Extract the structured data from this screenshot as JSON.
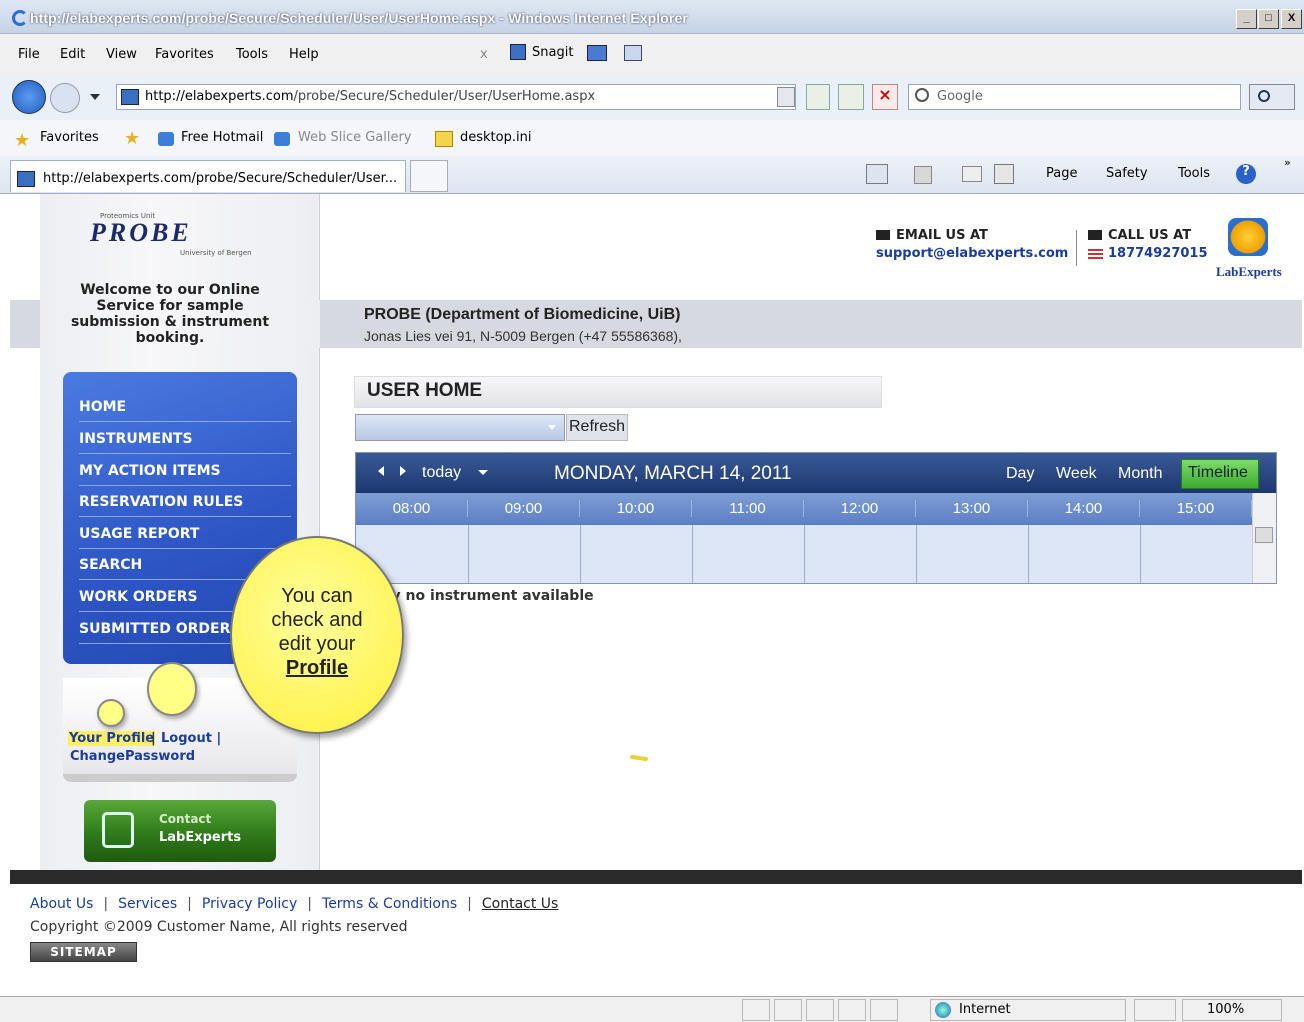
{
  "window": {
    "title": "http://elabexperts.com/probe/Secure/Scheduler/User/UserHome.aspx - Windows Internet Explorer",
    "min": "_",
    "max": "□",
    "close": "X"
  },
  "menu": {
    "items": [
      "File",
      "Edit",
      "View",
      "Favorites",
      "Tools",
      "Help"
    ],
    "close_x": "x",
    "snagit": "Snagit"
  },
  "address": {
    "url_dark": "http://elabexperts.com",
    "url_rest": "/probe/Secure/Scheduler/User/UserHome.aspx",
    "search_placeholder": "Google"
  },
  "favorites": {
    "label": "Favorites",
    "items": [
      "Free Hotmail",
      "Web Slice Gallery",
      "desktop.ini"
    ]
  },
  "tab": {
    "title": "http://elabexperts.com/probe/Secure/Scheduler/User...",
    "tools": [
      "Page",
      "Safety",
      "Tools"
    ]
  },
  "header": {
    "logo_small": "Proteomics Unit",
    "logo": "PROBE",
    "logo_sub": "University of Bergen",
    "email_label": "EMAIL US AT",
    "email": "support@elabexperts.com",
    "call_label": "CALL US AT",
    "phone": "18774927015",
    "brand": "LabExperts"
  },
  "welcome": "Welcome to our Online Service for sample submission & instrument booking.",
  "org": {
    "name": "PROBE (Department of Biomedicine, UiB)",
    "address": "Jonas Lies vei 91, N-5009 Bergen (+47 55586368),"
  },
  "nav": [
    "HOME",
    "INSTRUMENTS",
    "MY ACTION ITEMS",
    "RESERVATION RULES",
    "USAGE REPORT",
    "SEARCH",
    "WORK ORDERS",
    "SUBMITTED ORDERS"
  ],
  "profile": {
    "your_profile": "Your Profile",
    "sep": "|",
    "logout": "Logout |",
    "change_password": "ChangePassword"
  },
  "contact": {
    "line1": "Contact",
    "line2": "LabExperts"
  },
  "main": {
    "title": "USER HOME",
    "refresh": "Refresh",
    "no_instrument": "tly no instrument available"
  },
  "calendar": {
    "today": "today",
    "date": "MONDAY, MARCH 14, 2011",
    "views": [
      "Day",
      "Week",
      "Month",
      "Timeline"
    ],
    "hours": [
      "08:00",
      "09:00",
      "10:00",
      "11:00",
      "12:00",
      "13:00",
      "14:00",
      "15:00"
    ]
  },
  "callout": {
    "line1": "You can",
    "line2": "check and",
    "line3": "edit your",
    "profile": "Profile"
  },
  "footer": {
    "links": [
      "About Us",
      "Services",
      "Privacy Policy",
      "Terms & Conditions",
      "Contact Us"
    ],
    "copyright": "Copyright ©2009 Customer Name, All rights reserved",
    "sitemap": "SITEMAP"
  },
  "status": {
    "zone": "Internet",
    "zoom": "100%"
  },
  "colors": {
    "nav_blue": "#2d55c4",
    "callout_yellow": "#ffef3a",
    "calendar_header": "#1c3770",
    "timeline_green": "#3caa2e"
  }
}
